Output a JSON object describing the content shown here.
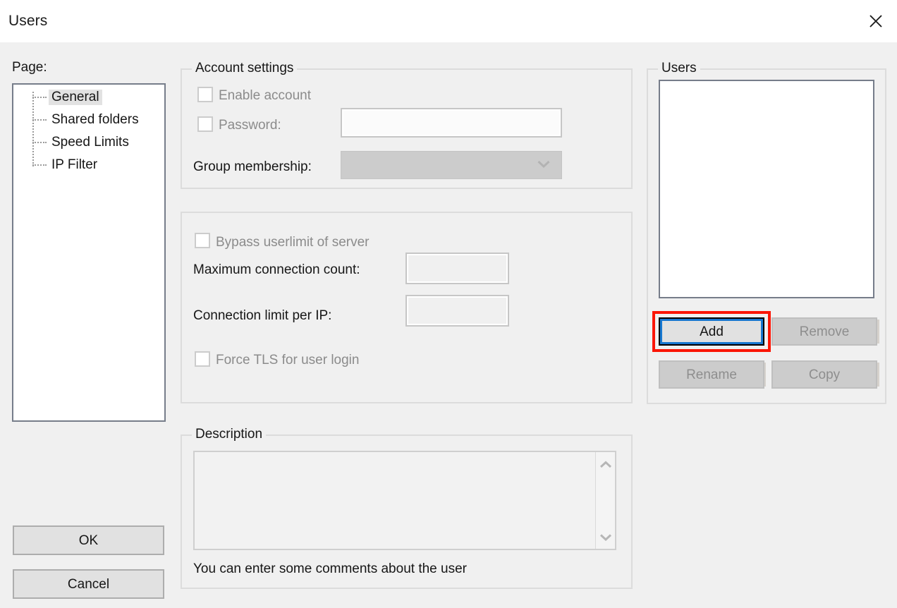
{
  "window": {
    "title": "Users",
    "close_icon": "close-icon"
  },
  "left_panel": {
    "page_label": "Page:",
    "tree_items": [
      {
        "label": "General",
        "selected": true
      },
      {
        "label": "Shared folders",
        "selected": false
      },
      {
        "label": "Speed Limits",
        "selected": false
      },
      {
        "label": "IP Filter",
        "selected": false
      }
    ],
    "ok_label": "OK",
    "cancel_label": "Cancel"
  },
  "account_settings": {
    "group_title": "Account settings",
    "enable_account_label": "Enable account",
    "enable_account_checked": false,
    "password_label": "Password:",
    "password_checked": false,
    "password_value": "",
    "group_membership_label": "Group membership:",
    "group_membership_value": "",
    "group_membership_chevron": "chevron-down-icon"
  },
  "limits": {
    "bypass_userlimit_label": "Bypass userlimit of server",
    "bypass_userlimit_checked": false,
    "max_connection_count_label": "Maximum connection count:",
    "max_connection_count_value": "",
    "connection_limit_per_ip_label": "Connection limit per IP:",
    "connection_limit_per_ip_value": "",
    "force_tls_label": "Force TLS for user login",
    "force_tls_checked": false
  },
  "description": {
    "group_title": "Description",
    "text_value": "",
    "hint": "You can enter some comments about the user",
    "scroll_up_icon": "chevron-up-icon",
    "scroll_down_icon": "chevron-down-icon"
  },
  "users_panel": {
    "group_title": "Users",
    "list_items": [],
    "buttons": {
      "add": "Add",
      "remove": "Remove",
      "rename": "Rename",
      "copy": "Copy"
    },
    "add_focused": true
  },
  "colors": {
    "dialog_bg": "#f0f0f0",
    "titlebar_bg": "#ffffff",
    "text": "#161616",
    "disabled_text": "#8e8e8e",
    "focus_ring": "#1878d0",
    "annotation": "#fb1606",
    "list_border": "#767d8a",
    "group_border": "#dcdcdc"
  }
}
